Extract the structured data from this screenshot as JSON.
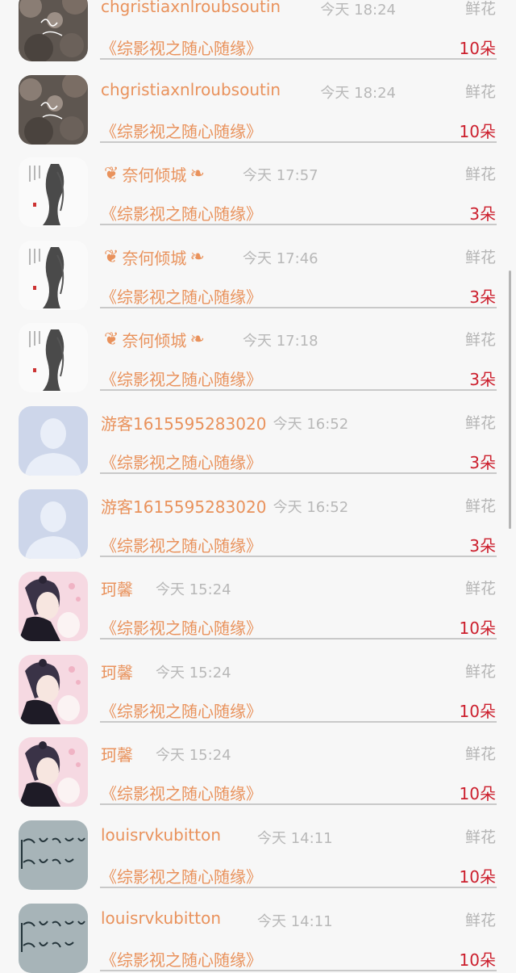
{
  "gifts": [
    {
      "name": "chgristiaxnlroubsoutin",
      "time": "今天 18:24",
      "category": "鲜花",
      "work": "《综影视之随心随缘》",
      "amount": "10朵",
      "avatar": "photo-avatar",
      "decorated": false
    },
    {
      "name": "chgristiaxnlroubsoutin",
      "time": "今天 18:24",
      "category": "鲜花",
      "work": "《综影视之随心随缘》",
      "amount": "10朵",
      "avatar": "photo-avatar",
      "decorated": false
    },
    {
      "name": "奈何倾城",
      "time": "今天 17:57",
      "category": "鲜花",
      "work": "《综影视之随心随缘》",
      "amount": "3朵",
      "avatar": "ink-painting-avatar",
      "decorated": true
    },
    {
      "name": "奈何倾城",
      "time": "今天 17:46",
      "category": "鲜花",
      "work": "《综影视之随心随缘》",
      "amount": "3朵",
      "avatar": "ink-painting-avatar",
      "decorated": true
    },
    {
      "name": "奈何倾城",
      "time": "今天 17:18",
      "category": "鲜花",
      "work": "《综影视之随心随缘》",
      "amount": "3朵",
      "avatar": "ink-painting-avatar",
      "decorated": true
    },
    {
      "name": "游客1615595283020",
      "time": "今天 16:52",
      "category": "鲜花",
      "work": "《综影视之随心随缘》",
      "amount": "3朵",
      "avatar": "default-user-avatar",
      "decorated": false
    },
    {
      "name": "游客1615595283020",
      "time": "今天 16:52",
      "category": "鲜花",
      "work": "《综影视之随心随缘》",
      "amount": "3朵",
      "avatar": "default-user-avatar",
      "decorated": false
    },
    {
      "name": "珂馨",
      "time": "今天 15:24",
      "category": "鲜花",
      "work": "《综影视之随心随缘》",
      "amount": "10朵",
      "avatar": "anime-avatar",
      "decorated": false
    },
    {
      "name": "珂馨",
      "time": "今天 15:24",
      "category": "鲜花",
      "work": "《综影视之随心随缘》",
      "amount": "10朵",
      "avatar": "anime-avatar",
      "decorated": false
    },
    {
      "name": "珂馨",
      "time": "今天 15:24",
      "category": "鲜花",
      "work": "《综影视之随心随缘》",
      "amount": "10朵",
      "avatar": "anime-avatar",
      "decorated": false
    },
    {
      "name": "louisrvkubitton",
      "time": "今天 14:11",
      "category": "鲜花",
      "work": "《综影视之随心随缘》",
      "amount": "10朵",
      "avatar": "handwriting-avatar",
      "decorated": false
    },
    {
      "name": "louisrvkubitton",
      "time": "今天 14:11",
      "category": "鲜花",
      "work": "《综影视之随心随缘》",
      "amount": "10朵",
      "avatar": "handwriting-avatar",
      "decorated": false
    }
  ],
  "colors": {
    "accent": "#e9925c",
    "amount": "#cc1f2d",
    "muted": "#b8b8b8",
    "background": "#f7f7f7"
  }
}
